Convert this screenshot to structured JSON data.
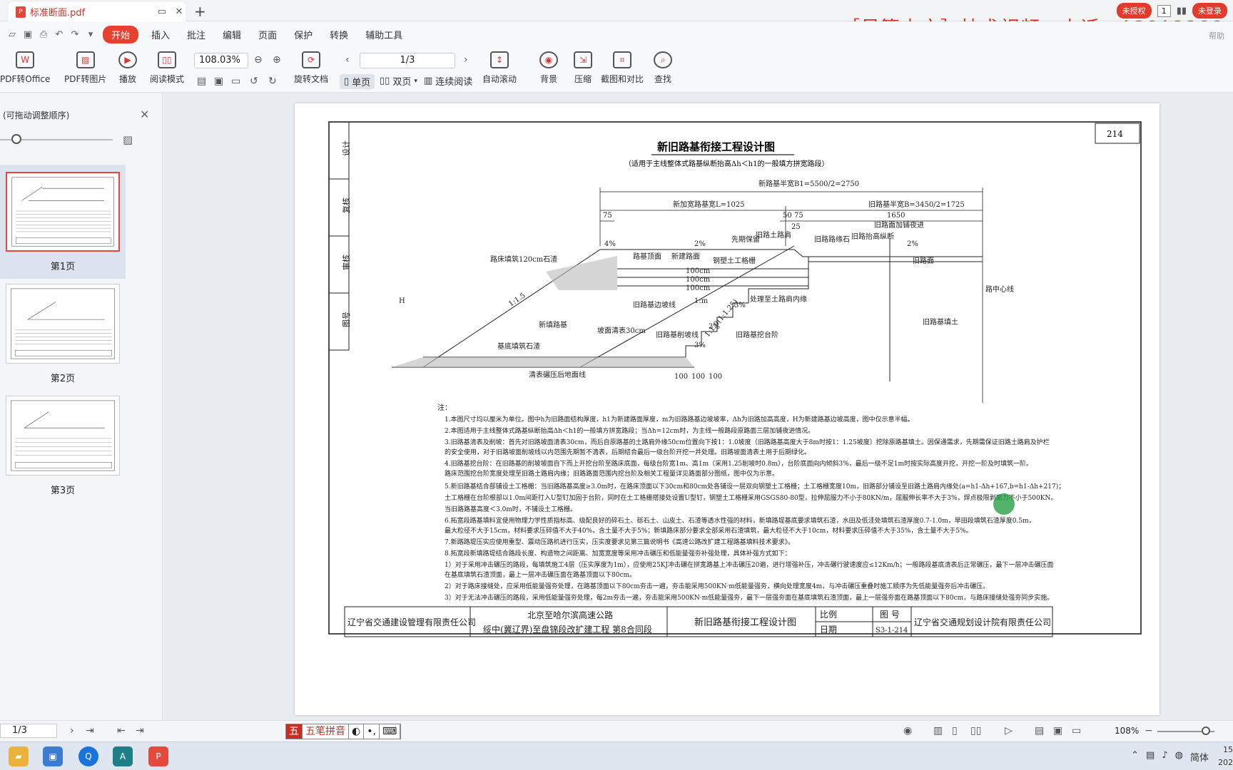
{
  "window": {
    "tab_title": "标准断面.pdf",
    "new_tab": "+",
    "unauthorized": "未授权",
    "page_badge": "1",
    "login": "未登录",
    "watermark": "［易算土方］技术视频，电话：13812289",
    "help": "帮助"
  },
  "menu": [
    "开始",
    "插入",
    "批注",
    "编辑",
    "页面",
    "保护",
    "转换",
    "辅助工具"
  ],
  "toolbar": {
    "pdf_to_office": "PDF转Office",
    "pdf_to_image": "PDF转图片",
    "play": "播放",
    "read_mode": "阅读模式",
    "zoom": "108.03%",
    "rotate": "旋转文档",
    "page_field": "1/3",
    "single": "单页",
    "double": "双页",
    "continuous": "连续阅读",
    "autoscroll": "自动滚动",
    "background": "背景",
    "compress": "压缩",
    "crop_compare": "截图和对比",
    "find": "查找"
  },
  "sidebar": {
    "title": "(可拖动调整顺序)",
    "pages": [
      "第1页",
      "第2页",
      "第3页"
    ]
  },
  "drawing": {
    "page_number": "214",
    "title": "新旧路基衔接工程设计图",
    "subtitle": "（适用于主线整体式路基纵断抬高Δh＜h1的一般填方拼宽路段）",
    "dims": {
      "half_width": "新路基半宽B1=5500/2=2750",
      "new_width": "新加宽路基宽L=1025",
      "old_width": "旧路基半宽B=3450/2=1725",
      "d75a": "75",
      "d50": "50",
      "d75b": "75",
      "d25": "25",
      "d1650": "1650",
      "d100a": "100",
      "d100b": "100",
      "d100c": "100"
    },
    "labels": {
      "old_pave_add": "旧路面加铺夜进",
      "p4": "4%",
      "p2a": "2%",
      "p2b": "2%",
      "p3a": "3%",
      "p3b": "3%",
      "p3c": "3%",
      "first_remove": "先期保留",
      "old_shoulder": "旧路土路肩",
      "old_curb": "旧路路缘石",
      "old_raise": "旧路抬高纵断",
      "subgrade_fill": "路床填筑120cm石渣",
      "new_top": "路基顶面",
      "new_pave": "新建路面",
      "geogrid": "钢塑土工格栅",
      "old_pave": "旧路面",
      "slope15": "1:1.5",
      "slope_m": "1:m",
      "slope10": "1:1.0(1:1.25)",
      "old_edge": "旧路基边坡线",
      "treat_shoulder": "处理至土路肩内缘",
      "new_fill": "新填路基",
      "clear30": "坡面清表30cm",
      "old_cut": "旧路基削坡线",
      "old_step": "旧路基挖台阶",
      "base_fill": "基底填筑石渣",
      "compact": "清表碾压后地面线",
      "old_fill": "旧路基填土",
      "center": "路中心线",
      "H": "H",
      "g1": "100cm",
      "g2": "100cm",
      "g3": "100cm"
    },
    "sidebar_stamps": [
      "设计",
      "复核",
      "审核",
      "图号"
    ],
    "notes_title": "注：",
    "notes": [
      "1.本图尺寸均以厘米为单位。图中h为旧路面结构厚度，h1为新建路面厚度，m为旧路路基边坡坡率，Δh为旧路加高高度，H为新建路基边坡高度，图中仅示意半幅。",
      "2.本图适用于主线整体式路基纵断抬高Δh＜h1的一般填方拼宽路段；当Δh=12cm时，为主线一般路段原路面三层加铺夜进情况。",
      "3.旧路基清表及削坡：首先对旧路坡面清表30cm，而后自原路基的土路肩外缘50cm位置向下按1：1.0坡度（旧路路基高度大于8m时按1：1.25坡度）挖除原路基填土。因保通需求，先期需保证旧路土路肩及护栏",
      "  的安全使用，对于旧路坡面削坡线以内范围先期暂不清表，后期结合最后一级台阶开挖一并处理。旧路坡面清表土用于后期绿化。",
      "4.旧路基挖台阶：在旧路基的削坡坡面自下而上开挖台阶至路床底面，每级台阶宽1m、高1m（采用1.25削坡时0.8m），台阶底面向内倾斜3%，最后一级不足1m时按实际高度开挖，开挖一阶及时填筑一阶。",
      "  路床范围挖台阶宽度处理至旧路土路肩内缘；旧路路面范围内挖台阶及相关工程量详见路面部分图纸，图中仅为示意。",
      "5.新旧路基结合部铺设土工格栅：当旧路路基高度≥3.0m时，在路床顶面以下30cm和80cm处各铺设一层双向钢塑土工格栅；土工格栅宽度10m，旧路部分铺设至旧路土路肩内缘处(a=h1-Δh+167,b=h1-Δh+217)；",
      "  土工格栅在台阶根部以1.0m间距打入U型钉加固于台阶，同时在土工格栅搭接处设置U型钉，钢塑土工格栅采用GSGS80-80型，拉伸屈服力不小于80KN/m，屈服伸长率不大于3%，焊点极限剥离力不小于500KN。",
      "  当旧路路基高度＜3.0m时，不铺设土工格栅。",
      "6.拓宽段路基填料宜使用物理力学性质指标高、级配良好的碎石土、砾石土、山皮土、石渣等透水性强的材料，新填路堤基底要求填筑石渣，水田及低洼处填筑石渣厚度0.7-1.0m，旱田段填筑石渣厚度0.5m，",
      "  最大粒径不大于15cm，材料要求压碎值不大于40%，含土量不大于5%；新填路床部分要求全部采用石渣填筑，最大粒径不大于10cm，材料要求压碎值不大于35%，含土量不大于5%。",
      "7.新路路堤压实应使用重型、震动压路机进行压实，压实度要求见第三篇说明书《高速公路改扩建工程路基填料技术要求》。",
      "8.拓宽段新填路堤结合路段长度、构造物之间距离、加宽宽度等采用冲击碾压和低能量强夯补强处理，具体补强方式如下：",
      "  1）对于采用冲击碾压的路段，每填筑施工4层（压实厚度为1m），应使用25KJ冲击碾在拼宽路基上冲击碾压20遍，进行增强补压，冲击碾行驶速度应≤12Km/h；一般路段基底清表后正常碾压，最下一层冲击碾压面",
      "    在基底填筑石渣顶面，最上一层冲击碾压面在路基顶面以下80cm。",
      "  2）对于路床接缝处，应采用低能量强夯处理，在路基顶面以下80cm夯击一遍，夯击能采用500KN·m低能量强夯，横向处理宽度4m，与冲击碾压重叠时施工顺序为先低能量强夯后冲击碾压。",
      "  3）对于无法冲击碾压的路段，采用低能量强夯处理，每2m夯击一遍，夯击能采用500KN·m低能量强夯，最下一层强夯面在基底填筑石渣顶面，最上一层强夯面在路基顶面以下80cm，与路床接缝处强夯同步实施。"
    ],
    "titleblock": {
      "owner": "辽宁省交通建设管理有限责任公司",
      "project1": "北京至哈尔滨高速公路",
      "project2": "绥中(冀辽界)至盘锦段改扩建工程 第8合同段",
      "title": "新旧路基衔接工程设计图",
      "scale": "比例",
      "date": "日期",
      "drawing_no_label": "图  号",
      "drawing_no": "S3-1-214",
      "designer": "辽宁省交通规划设计院有限责任公司"
    }
  },
  "status": {
    "page": "1/3",
    "ime_name": "五笔拼音",
    "zoom": "108%"
  },
  "tray": {
    "lang": "简体",
    "clock1": "15",
    "clock2": "202"
  }
}
